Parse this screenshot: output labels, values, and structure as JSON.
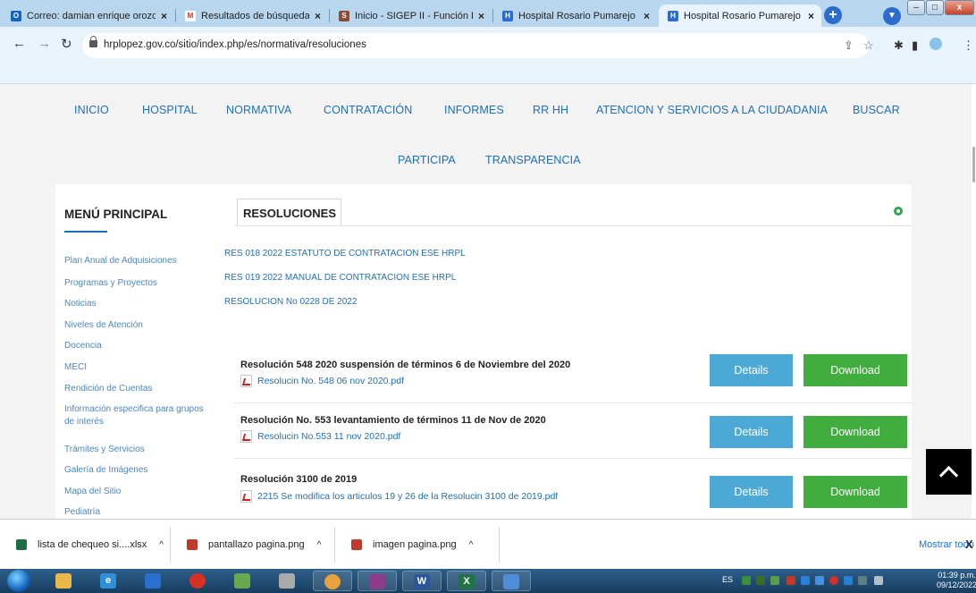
{
  "browser": {
    "tabs": [
      {
        "title": "Correo: damian enrique orozco",
        "favicon": "outlook-icon",
        "color": "#1565c0"
      },
      {
        "title": "Resultados de búsqueda - cint",
        "favicon": "gmail-icon",
        "color": "#d93025"
      },
      {
        "title": "Inicio - SIGEP II - Función Públ",
        "favicon": "sigep-icon",
        "color": "#8b4c3a"
      },
      {
        "title": "Hospital Rosario Pumarejo de",
        "favicon": "hospital-icon",
        "color": "#2b6ccc"
      },
      {
        "title": "Hospital Rosario Pumarejo de",
        "favicon": "hospital-icon",
        "color": "#2b6ccc"
      }
    ],
    "tab_close": "×",
    "new_tab": "+",
    "url": "hrplopez.gov.co/sitio/index.php/es/normativa/resoluciones",
    "window_controls": {
      "minimize": "–",
      "maximize": "□",
      "close": "x"
    }
  },
  "nav": {
    "row1": [
      "INICIO",
      "HOSPITAL",
      "NORMATIVA",
      "CONTRATACIÓN",
      "INFORMES",
      "RR HH",
      "ATENCION Y SERVICIOS A LA CIUDADANIA",
      "BUSCAR"
    ],
    "row2": [
      "PARTICIPA",
      "TRANSPARENCIA"
    ]
  },
  "sidebar": {
    "title": "MENÚ PRINCIPAL",
    "items": [
      "Plan Anual de Adquisiciones",
      "Programas y Proyectos",
      "Noticias",
      "Niveles de Atención",
      "Docencia",
      "MECI",
      "Rendición de Cuentas",
      "Información especifica para grupos de interés",
      "Trámites y Servicios",
      "Galería de Imágenes",
      "Mapa del Sitio",
      "Pediatría"
    ]
  },
  "main": {
    "tab_label": "RESOLUCIONES",
    "links": [
      "RES 018 2022 ESTATUTO DE CONTRATACION ESE HRPL",
      "RES 019 2022 MANUAL DE CONTRATACION ESE HRPL",
      "RESOLUCION No 0228 DE 2022"
    ],
    "documents": [
      {
        "title": "Resolución 548 2020 suspensión de términos 6 de Noviembre del 2020",
        "file": "Resolucin No. 548 06 nov 2020.pdf"
      },
      {
        "title": "Resolución No. 553 levantamiento de términos 11 de Nov de 2020",
        "file": "Resolucin No.553 11 nov 2020.pdf"
      },
      {
        "title": "Resolución 3100 de 2019",
        "file": "2215 Se modifica los articulos 19 y 26 de la Resolucin 3100 de 2019.pdf"
      }
    ],
    "details_label": "Details",
    "download_label": "Download"
  },
  "downloads": {
    "items": [
      {
        "name": "lista de chequeo si....xlsx",
        "icon": "excel-file-icon",
        "color": "#1d6f42"
      },
      {
        "name": "pantallazo pagina.png",
        "icon": "image-file-icon",
        "color": "#c0392b"
      },
      {
        "name": "imagen pagina.png",
        "icon": "image-file-icon",
        "color": "#c0392b"
      }
    ],
    "chevron": "^",
    "show_all": "Mostrar todo",
    "close": "X"
  },
  "taskbar": {
    "lang": "ES",
    "time": "01:39 p.m.",
    "date": "09/12/2022"
  },
  "colors": {
    "link": "#1e6fb8",
    "details": "#4ca9d6",
    "download": "#42ad3f",
    "tabbar": "#b8d6ee"
  }
}
